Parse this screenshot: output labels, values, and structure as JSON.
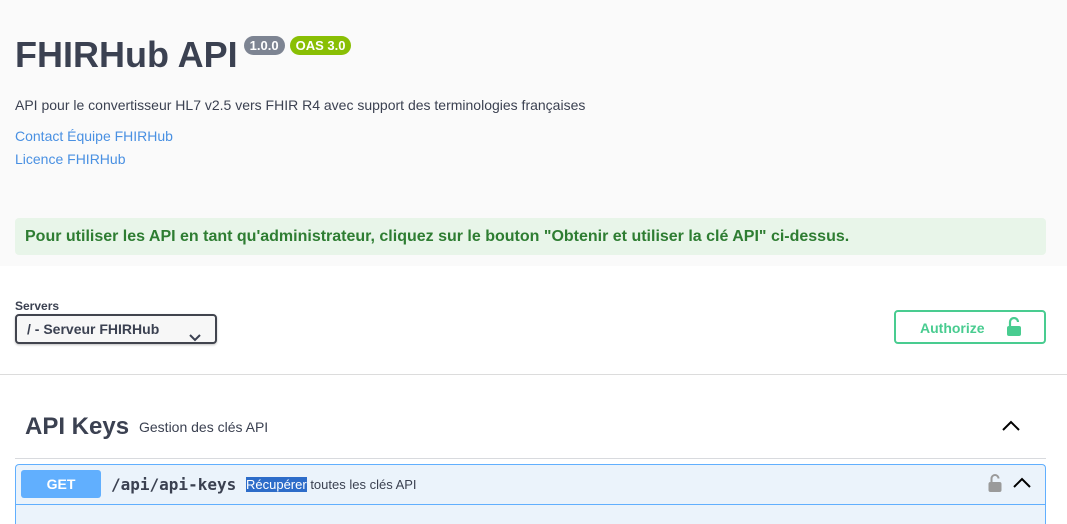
{
  "info": {
    "title": "FHIRHub API",
    "version_badge": "1.0.0",
    "oas_badge": "OAS 3.0",
    "description": "API pour le convertisseur HL7 v2.5 vers FHIR R4 avec support des terminologies françaises",
    "contact_link": "Contact Équipe FHIRHub",
    "license_link": "Licence FHIRHub",
    "notice": "Pour utiliser les API en tant qu'administrateur, cliquez sur le bouton \"Obtenir et utiliser la clé API\" ci-dessus."
  },
  "servers": {
    "label": "Servers",
    "selected": "/ - Serveur FHIRHub"
  },
  "authorize": {
    "label": "Authorize"
  },
  "tag": {
    "name": "API Keys",
    "description": "Gestion des clés API"
  },
  "operation": {
    "method": "GET",
    "path": "/api/api-keys",
    "summary_highlight": "Récupérer",
    "summary_rest": " toutes les clés API"
  },
  "colors": {
    "get": "#61affe",
    "authorize": "#49cc90",
    "notice_text": "#2e7d32",
    "notice_bg": "#e8f5e9",
    "link": "#4990e2"
  },
  "icons": [
    "chevron-down-icon",
    "unlock-icon",
    "chevron-up-icon",
    "lock-icon"
  ]
}
